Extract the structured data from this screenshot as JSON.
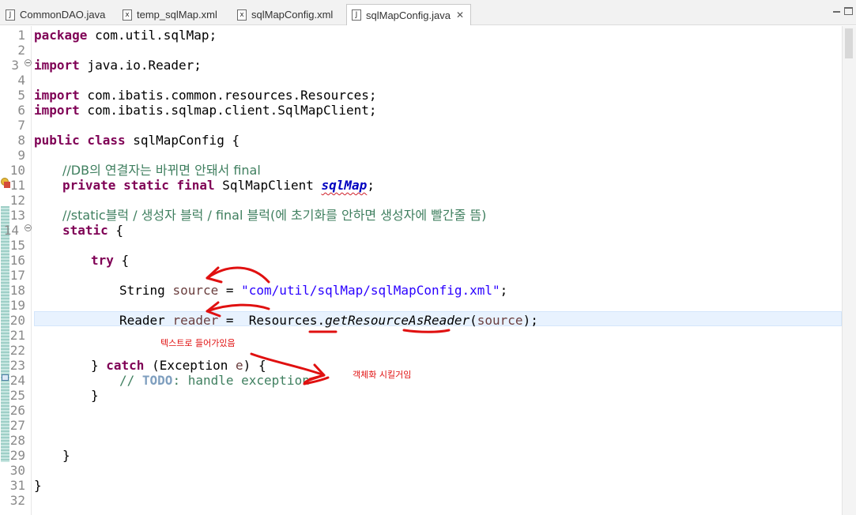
{
  "tabs": [
    {
      "label": "CommonDAO.java",
      "icon": "java-file-icon",
      "icon_glyph": "J"
    },
    {
      "label": "temp_sqlMap.xml",
      "icon": "xml-file-icon",
      "icon_glyph": "x"
    },
    {
      "label": "sqlMapConfig.xml",
      "icon": "xml-file-icon",
      "icon_glyph": "x"
    },
    {
      "label": "sqlMapConfig.java",
      "icon": "java-file-icon",
      "icon_glyph": "J",
      "active": true
    }
  ],
  "close_glyph": "✕",
  "line_numbers": [
    "1",
    "2",
    "3",
    "4",
    "5",
    "6",
    "7",
    "8",
    "9",
    "10",
    "11",
    "12",
    "13",
    "14",
    "15",
    "16",
    "17",
    "18",
    "19",
    "20",
    "21",
    "22",
    "23",
    "24",
    "25",
    "26",
    "27",
    "28",
    "29",
    "30",
    "31",
    "32"
  ],
  "code": {
    "l1_kw": "package",
    "l1_rest": " com.util.sqlMap;",
    "l3_kw": "import",
    "l3_rest": " java.io.Reader;",
    "l5_kw": "import",
    "l5_rest": " com.ibatis.common.resources.Resources;",
    "l6_kw": "import",
    "l6_rest": " com.ibatis.sqlmap.client.SqlMapClient;",
    "l8_kw": "public class",
    "l8_rest": " sqlMapConfig {",
    "l10_cm": "//DB의 연결자는 바뀌면 안돼서 final",
    "l11_kw": "private static final",
    "l11_type": " SqlMapClient ",
    "l11_field": "sqlMap",
    "l11_end": ";",
    "l13_cm": "//static블럭 / 생성자 블럭 / final 블럭(에 초기화를 안하면 생성자에 빨간줄 뜸)",
    "l14_kw": "static",
    "l14_rest": " {",
    "l16_kw": "try",
    "l16_rest": " {",
    "l18_type": "String ",
    "l18_var": "source",
    "l18_eq": " = ",
    "l18_str": "\"com/util/sqlMap/sqlMapConfig.xml\"",
    "l18_end": ";",
    "l20_type": "Reader ",
    "l20_var": "reader",
    "l20_eq": " =  Resources.",
    "l20_method": "getResourceAsReader",
    "l20_open": "(",
    "l20_arg": "source",
    "l20_end": ");",
    "l23_a": "} ",
    "l23_kw": "catch",
    "l23_b": " (Exception ",
    "l23_var": "e",
    "l23_c": ") {",
    "l24_a": "// ",
    "l24_todo": "TODO",
    "l24_b": ": handle exception",
    "l25": "}",
    "l29": "}",
    "l31": "}"
  },
  "annotations": {
    "note1": "텍스트로 들어가있음",
    "note2": "객체화 시킬거임"
  },
  "colors": {
    "keyword": "#7f0055",
    "comment": "#3f7f5f",
    "string": "#2a00ff",
    "field": "#0000c0",
    "annotation_ink": "#e01010",
    "current_line": "#e8f2fe"
  }
}
